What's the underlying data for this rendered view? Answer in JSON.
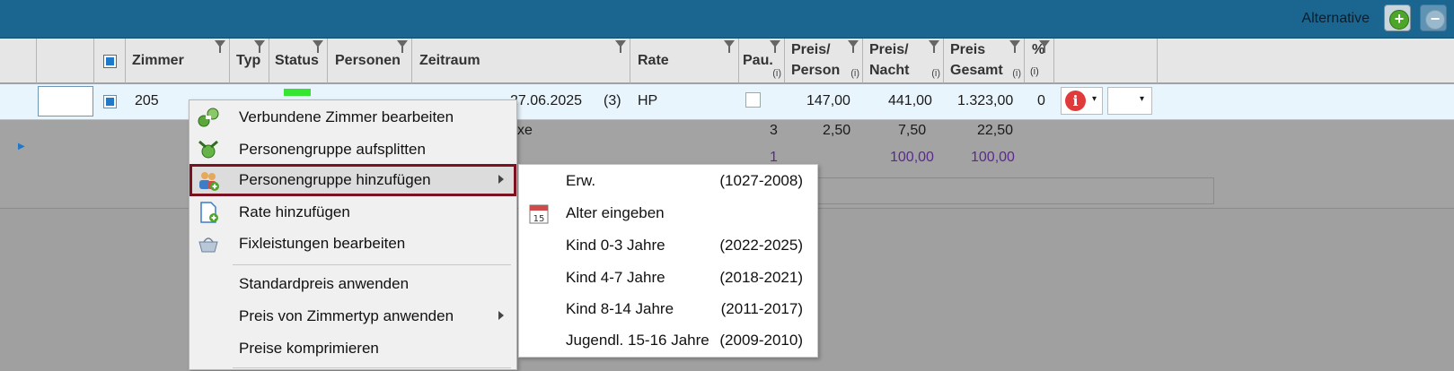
{
  "toolbar": {
    "alternative_label": "Alternative",
    "add_symbol": "+",
    "remove_symbol": "−"
  },
  "columns": {
    "zimmer": "Zimmer",
    "typ": "Typ",
    "status": "Status",
    "personen": "Personen",
    "zeitraum": "Zeitraum",
    "rate": "Rate",
    "pau": "Pau.",
    "info": "(i)",
    "preis_person_1": "Preis/",
    "preis_person_2": "Person",
    "preis_nacht_1": "Preis/",
    "preis_nacht_2": "Nacht",
    "preis_gesamt_1": "Preis",
    "preis_gesamt_2": "Gesamt",
    "prozent_1": "%",
    "prozent_2": "(i)"
  },
  "row": {
    "zimmer": "205",
    "zeitraum_end": "27.06.2025",
    "nights": "(3)",
    "rate": "HP",
    "preis_person": "147,00",
    "preis_nacht": "441,00",
    "preis_gesamt": "1.323,00",
    "prozent": "0",
    "info_symbol": "i",
    "dropdown_arrow": "▾"
  },
  "subrows": [
    {
      "text": "xe",
      "qty": "3",
      "person": "2,50",
      "nacht": "7,50",
      "gesamt": "22,50"
    },
    {
      "qty": "1",
      "nacht": "100,00",
      "gesamt": "100,00"
    }
  ],
  "context_menu": [
    {
      "label": "Verbundene Zimmer bearbeiten",
      "icon": "link-rooms-icon"
    },
    {
      "label": "Personengruppe aufsplitten",
      "icon": "split-group-icon"
    },
    {
      "label": "Personengruppe hinzufügen",
      "icon": "add-group-icon"
    },
    {
      "label": "Rate hinzufügen",
      "icon": "add-rate-icon"
    },
    {
      "label": "Fixleistungen bearbeiten",
      "icon": "basket-icon"
    },
    {
      "label": "Standardpreis anwenden"
    },
    {
      "label": "Preis von Zimmertyp anwenden"
    },
    {
      "label": "Preise komprimieren"
    }
  ],
  "submenu": [
    {
      "label": "Erw.",
      "years": "(1027-2008)"
    },
    {
      "label": "Alter eingeben",
      "years": "",
      "icon": "calendar-icon",
      "icon_text": "15"
    },
    {
      "label": "Kind 0-3 Jahre",
      "years": "(2022-2025)"
    },
    {
      "label": "Kind 4-7 Jahre",
      "years": "(2018-2021)"
    },
    {
      "label": "Kind 8-14 Jahre",
      "years": "(2011-2017)"
    },
    {
      "label": "Jugendl. 15-16 Jahre",
      "years": "(2009-2010)"
    }
  ]
}
